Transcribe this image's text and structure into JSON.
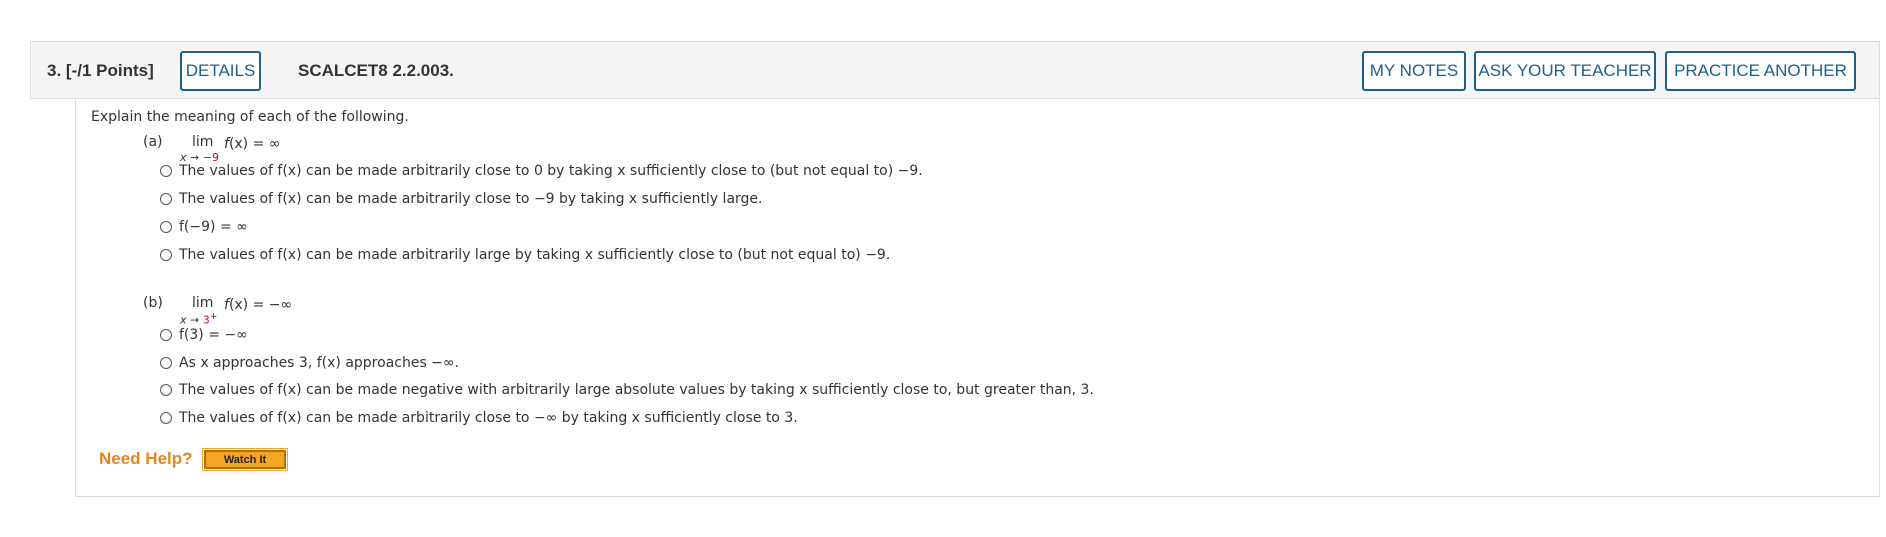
{
  "question": {
    "number": "3.",
    "points": "[-/1 Points]",
    "code": "SCALCET8 2.2.003."
  },
  "header_buttons": {
    "details": "DETAILS",
    "my_notes": "MY NOTES",
    "ask_teacher": "ASK YOUR TEACHER",
    "practice": "PRACTICE ANOTHER"
  },
  "intro": "Explain the meaning of each of the following.",
  "part_a": {
    "label": "(a)",
    "lim_word": "lim",
    "lim_var": "x →",
    "lim_target": "−9",
    "expr_func": "f",
    "expr_rest": "(x) = ∞",
    "options": [
      "The values of f(x) can be made arbitrarily close to 0 by taking x sufficiently close to (but not equal to) −9.",
      "The values of f(x) can be made arbitrarily close to −9 by taking x sufficiently large.",
      "f(−9) = ∞",
      "The values of f(x) can be made arbitrarily large by taking x sufficiently close to (but not equal to) −9."
    ]
  },
  "part_b": {
    "label": "(b)",
    "lim_word": "lim",
    "lim_var": "x →",
    "lim_target": "3",
    "lim_sup": "+",
    "expr_func": "f",
    "expr_rest": "(x) = −∞",
    "options": [
      "f(3) = −∞",
      "As x approaches 3, f(x) approaches −∞.",
      "The values of f(x) can be made negative with arbitrarily large absolute values by taking x sufficiently close to, but greater than, 3.",
      "The values of f(x) can be made arbitrarily close to −∞ by taking x sufficiently close to 3."
    ]
  },
  "help": {
    "label": "Need Help?",
    "watch_button": "Watch It"
  }
}
